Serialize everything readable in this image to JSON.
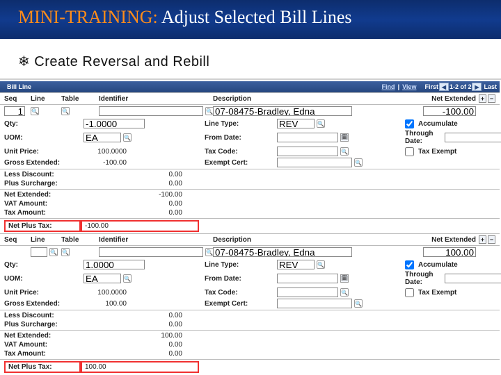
{
  "banner": {
    "prefix": "MINI-TRAINING:",
    "rest": " Adjust Selected Bill Lines"
  },
  "subhead": {
    "bullet": "❄",
    "text": "Create Reversal and Rebill"
  },
  "tabbar": {
    "title": "Bill Line",
    "find": "Find",
    "view": "View",
    "first": "First",
    "range": "1-2 of 2",
    "last": "Last"
  },
  "headers": {
    "seq": "Seq",
    "line": "Line",
    "table": "Table",
    "identifier": "Identifier",
    "description": "Description",
    "net_extended": "Net Extended"
  },
  "labels": {
    "qty": "Qty:",
    "uom": "UOM:",
    "unit_price": "Unit Price:",
    "gross_extended": "Gross Extended:",
    "line_type": "Line Type:",
    "from_date": "From Date:",
    "tax_code": "Tax Code:",
    "exempt_cert": "Exempt Cert:",
    "accumulate": "Accumulate",
    "through_date": "Through Date:",
    "tax_exempt": "Tax Exempt",
    "less_discount": "Less Discount:",
    "plus_surcharge": "Plus Surcharge:",
    "net_extended": "Net Extended:",
    "vat_amount": "VAT Amount:",
    "tax_amount": "Tax Amount:",
    "net_plus_tax": "Net Plus Tax:"
  },
  "negative": {
    "seq": "1",
    "desc": "07-08475-Bradley, Edna",
    "net_ext": "-100.00",
    "qty": "-1.0000",
    "uom": "EA",
    "line_type": "REV",
    "unit_price": "100.0000",
    "gross_ext": "-100.00",
    "less_discount": "0.00",
    "plus_surcharge": "0.00",
    "tot_net_ext": "-100.00",
    "vat": "0.00",
    "tax": "0.00",
    "net_plus_tax": "-100.00"
  },
  "positive": {
    "line": "",
    "desc": "07-08475-Bradley, Edna",
    "net_ext": "100.00",
    "qty": "1.0000",
    "uom": "EA",
    "line_type": "REV",
    "unit_price": "100.0000",
    "gross_ext": "100.00",
    "less_discount": "0.00",
    "plus_surcharge": "0.00",
    "tot_net_ext": "100.00",
    "vat": "0.00",
    "tax": "0.00",
    "net_plus_tax": "100.00"
  },
  "buttons": {
    "plus": "+",
    "minus": "−",
    "left": "◀",
    "right": "▶"
  }
}
